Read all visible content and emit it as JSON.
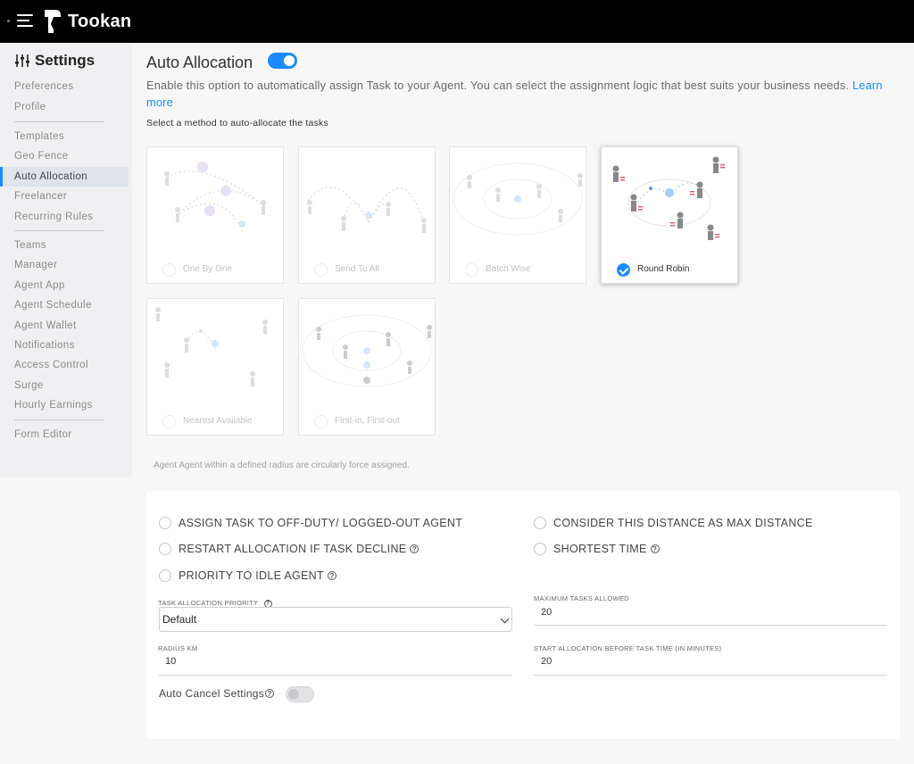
{
  "app": {
    "brand": "Tookan"
  },
  "sidebar": {
    "title": "Settings",
    "items": [
      {
        "label": "Preferences"
      },
      {
        "label": "Profile"
      },
      {
        "label": "Templates"
      },
      {
        "label": "Geo Fence"
      },
      {
        "label": "Auto Allocation",
        "active": true
      },
      {
        "label": "Freelancer"
      },
      {
        "label": "Recurring Rules"
      },
      {
        "label": "Teams"
      },
      {
        "label": "Manager"
      },
      {
        "label": "Agent App"
      },
      {
        "label": "Agent Schedule"
      },
      {
        "label": "Agent Wallet"
      },
      {
        "label": "Notifications"
      },
      {
        "label": "Access Control"
      },
      {
        "label": "Surge"
      },
      {
        "label": "Hourly Earnings"
      },
      {
        "label": "Form Editor"
      }
    ]
  },
  "main": {
    "title": "Auto Allocation",
    "enabled": true,
    "description": "Enable this option to automatically assign Task to your Agent. You can select the assignment logic that best suits your business needs.",
    "learn_more": "Learn more",
    "select_method": "Select a method to auto-allocate the tasks",
    "methods": [
      {
        "label": "One By One",
        "selected": false
      },
      {
        "label": "Send To All",
        "selected": false
      },
      {
        "label": "Batch Wise",
        "selected": false
      },
      {
        "label": "Round Robin",
        "selected": true
      },
      {
        "label": "Nearest Available",
        "selected": false
      },
      {
        "label": "First-in, First-out",
        "selected": false
      }
    ],
    "note": "Agent Agent within a defined radius are circularly force assigned."
  },
  "options": {
    "assign_off_duty": "ASSIGN TASK TO OFF-DUTY/ LOGGED-OUT AGENT",
    "restart_allocation": "RESTART ALLOCATION IF TASK DECLINE",
    "priority_idle": "PRIORITY TO IDLE AGENT",
    "max_distance": "CONSIDER THIS DISTANCE AS MAX DISTANCE",
    "shortest_time": "SHORTEST TIME"
  },
  "fields": {
    "task_priority_label": "TASK ALLOCATION PRIORITY",
    "task_priority_value": "Default",
    "radius_label": "RADIUS KM",
    "radius_value": "10",
    "max_tasks_label": "MAXIMUM TASKS ALLOWED",
    "max_tasks_value": "20",
    "start_before_label": "START ALLOCATION BEFORE TASK TIME (IN MINUTES)",
    "start_before_value": "20",
    "auto_cancel_label": "Auto Cancel Settings",
    "auto_cancel_enabled": false
  },
  "colors": {
    "accent": "#1a8cff",
    "topbar": "#000000"
  }
}
